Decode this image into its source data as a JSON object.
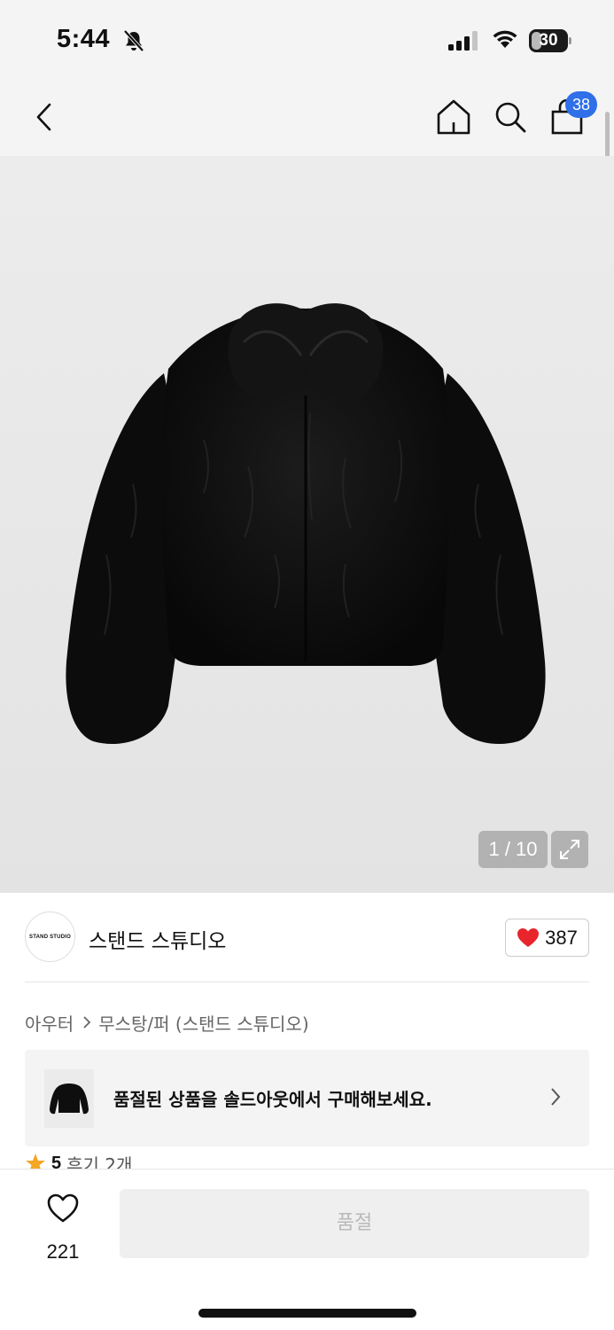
{
  "status_bar": {
    "time": "5:44",
    "battery": "30",
    "battery_level": 0.3,
    "icons": [
      "bell-slash-icon",
      "signal-icon",
      "wifi-icon",
      "battery-icon"
    ]
  },
  "nav": {
    "icons": [
      "chevron-left-icon",
      "home-icon",
      "search-icon",
      "shopping-bag-icon"
    ],
    "cart_badge": "38"
  },
  "gallery": {
    "counter": "1 / 10",
    "expand_icon": "expand-icon"
  },
  "brand": {
    "logo_text": "STAND STUDIO",
    "name": "스탠드 스튜디오",
    "like_count": "387",
    "like_color": "#e8242c"
  },
  "breadcrumb": {
    "items": [
      "아우터",
      "무스탕/퍼 (스탠드 스튜디오)"
    ]
  },
  "soldout_banner": {
    "text": "품절된 상품을 솔드아웃에서 구매해보세요."
  },
  "review": {
    "score": "5",
    "count_label": "후기 2개",
    "star_color": "#f5a623"
  },
  "bottom_bar": {
    "wish_count": "221",
    "action_label": "품절"
  },
  "colors": {
    "accent_badge": "#2f6fe8",
    "heart": "#e8242c"
  }
}
